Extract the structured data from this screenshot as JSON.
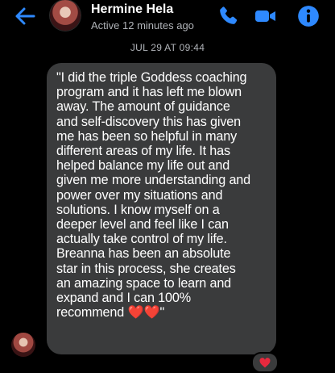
{
  "header": {
    "name": "Hermine Hela",
    "status": "Active 12 minutes ago"
  },
  "conversation": {
    "date_separator": "JUL 29 AT 09:44",
    "message": {
      "text": "\"I did the triple Goddess coaching\nprogram and it has left me blown\naway. The amount of guidance\nand self-discovery this has given\nme has been so helpful in many\ndifferent areas of my life. It has\nhelped balance my life out and\ngiven me more understanding and\npower over my situations and\nsolutions. I know myself on a\ndeeper level and feel like I can\nactually take control of my life.\nBreanna has been an absolute\nstar in this process, she creates\nan amazing space to learn and\nexpand and I can 100%\nrecommend ❤️❤️\"",
      "reaction_icon": "heart-icon"
    }
  },
  "colors": {
    "accent": "#2e89ff",
    "background": "#000000",
    "bubble": "#3a3b3c",
    "heart": "#e8293e"
  },
  "icons": [
    "back-arrow-icon",
    "phone-icon",
    "video-camera-icon",
    "info-icon",
    "heart-icon"
  ]
}
